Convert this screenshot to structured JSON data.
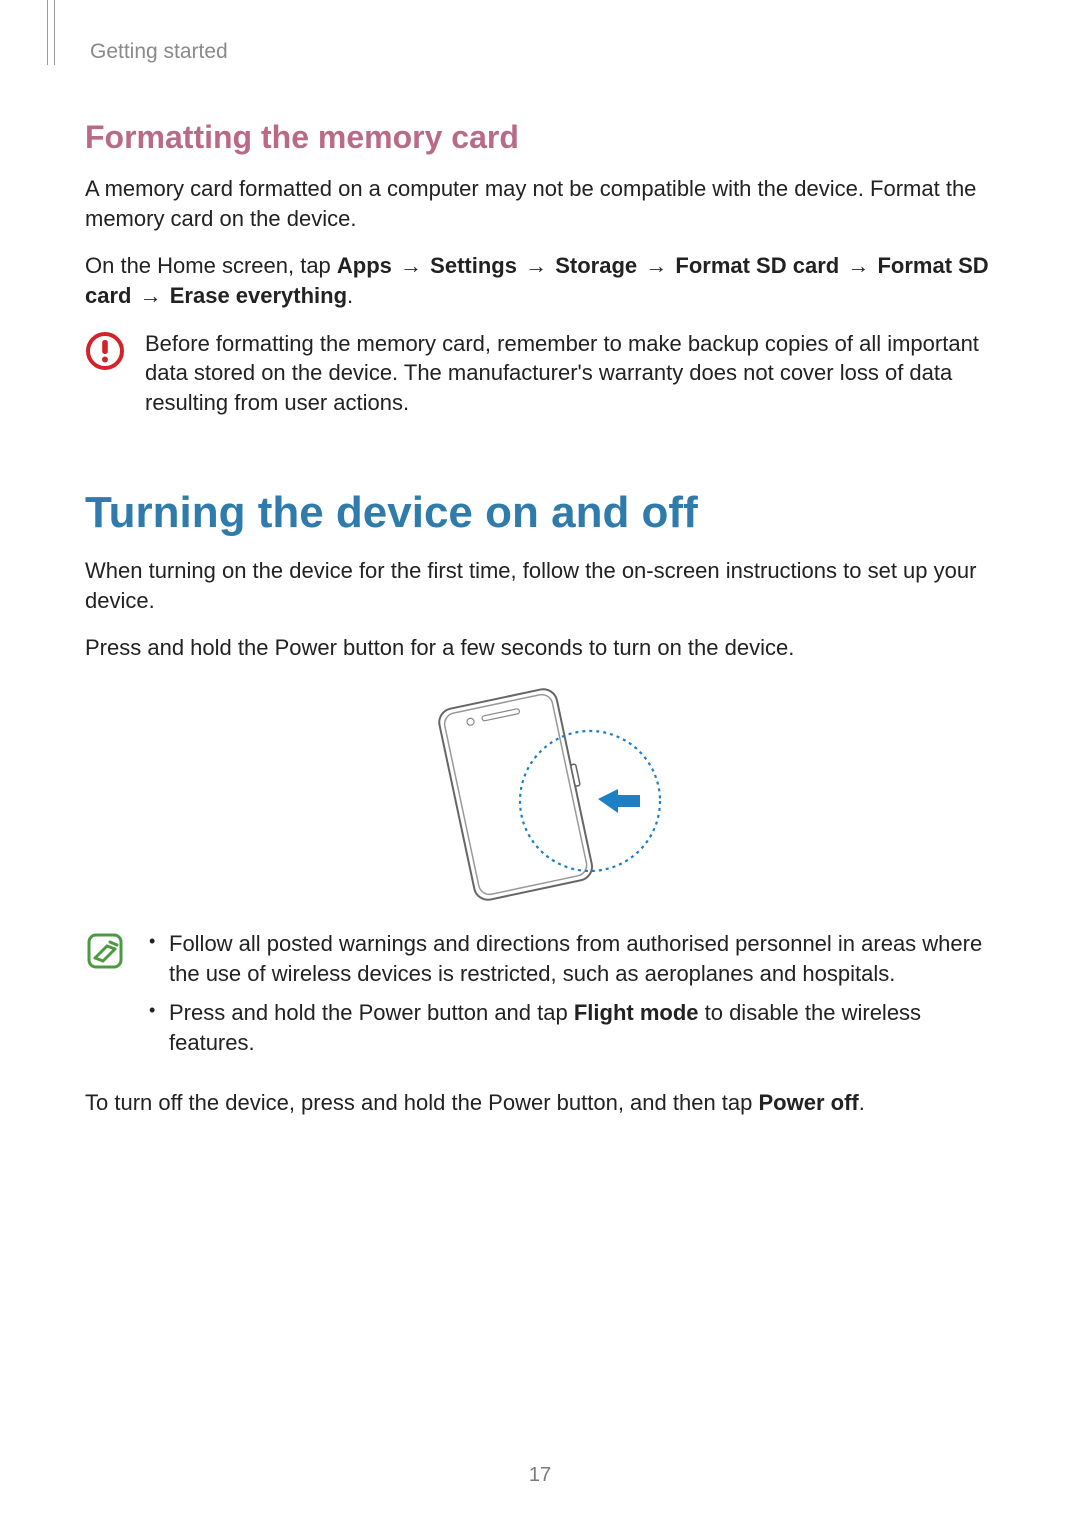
{
  "running_head": "Getting started",
  "section1": {
    "title": "Formatting the memory card",
    "p1": "A memory card formatted on a computer may not be compatible with the device. Format the memory card on the device.",
    "p2_lead": "On the Home screen, tap ",
    "path": [
      "Apps",
      "Settings",
      "Storage",
      "Format SD card",
      "Format SD card",
      "Erase everything"
    ],
    "p2_tail": ".",
    "warning": "Before formatting the memory card, remember to make backup copies of all important data stored on the device. The manufacturer's warranty does not cover loss of data resulting from user actions."
  },
  "section2": {
    "title": "Turning the device on and off",
    "p1": "When turning on the device for the first time, follow the on-screen instructions to set up your device.",
    "p2": "Press and hold the Power button for a few seconds to turn on the device.",
    "notes": {
      "item1": "Follow all posted warnings and directions from authorised personnel in areas where the use of wireless devices is restricted, such as aeroplanes and hospitals.",
      "item2_a": "Press and hold the Power button and tap ",
      "item2_bold": "Flight mode",
      "item2_b": " to disable the wireless features."
    },
    "p3_a": "To turn off the device, press and hold the Power button, and then tap ",
    "p3_bold": "Power off",
    "p3_b": "."
  },
  "page_number": "17",
  "arrow_glyph": "→"
}
